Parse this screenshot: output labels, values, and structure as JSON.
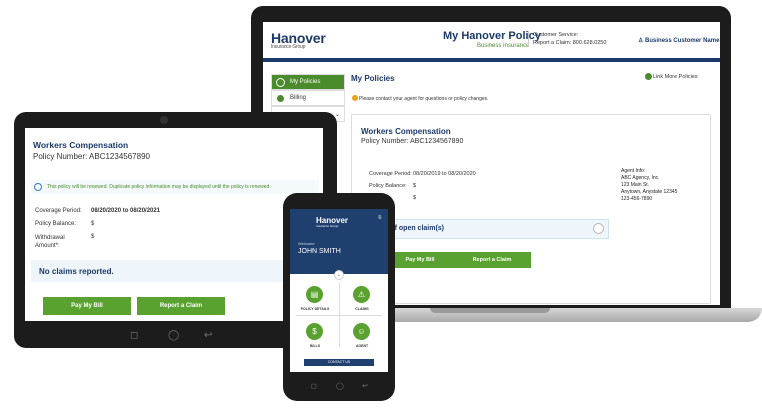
{
  "laptop": {
    "brand": {
      "name": "Hanover",
      "tagline": "Insurance Group"
    },
    "title": "My Hanover Policy",
    "subtitle": "Business Insurance",
    "customer_service": "Customer Service:",
    "report_claim": "Report a Claim:",
    "phone": "800.628.0250",
    "user": "Business Customer Name",
    "sidebar": [
      {
        "label": "My Policies",
        "active": true
      },
      {
        "label": "Billing",
        "active": false
      },
      {
        "label": "",
        "active": false
      }
    ],
    "page_title": "My Policies",
    "link_more": "Link More Policies",
    "notice": "Please contact your agent for questions or policy changes.",
    "card": {
      "title": "Workers Compensation",
      "policy": "Policy Number: ABC1234567890",
      "coverage_label": "Coverage Period:",
      "coverage_value": "08/20/2019 to 08/20/2020",
      "balance_label": "Policy Balance:",
      "balance_value": "$",
      "row3_value": "$",
      "agent": [
        "Agent Info:",
        "ABC Agency, Inc.",
        "123 Main St.",
        "Anytown, Anystate 12345",
        "123-456-7890"
      ],
      "claims": "Status of open claim(s)",
      "pay": "Pay My Bill",
      "report": "Report a Claim"
    }
  },
  "tablet": {
    "title": "Workers Compensation",
    "policy_label": "Policy Number:",
    "policy_value": "ABC1234567890",
    "notice": "This policy will be renewed. Duplicate policy information may be displayed until the policy is renewed.",
    "coverage_label": "Coverage Period:",
    "coverage_value": "08/20/2020 to 08/20/2021",
    "balance_label": "Policy Balance:",
    "balance_value": "$",
    "withdrawal_label": "Withdrawal Amount*:",
    "withdrawal_value": "$",
    "no_claims": "No claims reported.",
    "pay": "Pay My Bill",
    "report": "Report a Claim",
    "nav": [
      "◻",
      "◯",
      "↩"
    ]
  },
  "phone": {
    "brand": {
      "name": "Hanover",
      "tagline": "Insurance Group"
    },
    "welcome": "Welcome",
    "name": "JOHN SMITH",
    "tiles": [
      {
        "label": "POLICY DETAILS",
        "icon": "policy-icon",
        "glyph": "▤"
      },
      {
        "label": "CLAIMS",
        "icon": "warning-icon",
        "glyph": "⚠"
      },
      {
        "label": "BILLS",
        "icon": "bill-icon",
        "glyph": "$"
      },
      {
        "label": "AGENT",
        "icon": "agent-icon",
        "glyph": "☺"
      }
    ],
    "contact": "CONTACT US",
    "nav": [
      "◻",
      "◯",
      "↩"
    ]
  },
  "colors": {
    "navy": "#1b3a6b",
    "green": "#5aa230"
  }
}
